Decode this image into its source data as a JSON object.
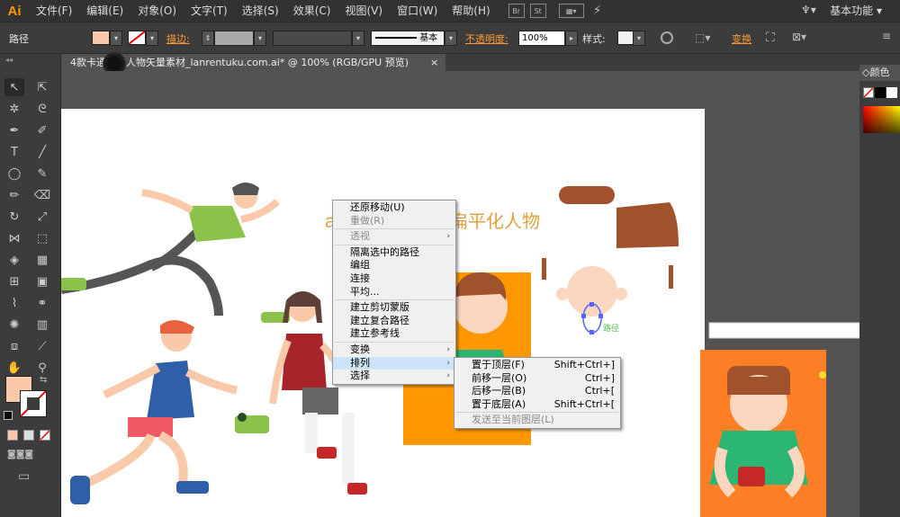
{
  "app": {
    "logo": "Ai",
    "workspace": "基本功能"
  },
  "menus": [
    "文件(F)",
    "编辑(E)",
    "对象(O)",
    "文字(T)",
    "选择(S)",
    "效果(C)",
    "视图(V)",
    "窗口(W)",
    "帮助(H)"
  ],
  "menubar_icons": [
    "Br",
    "St"
  ],
  "control": {
    "selection": "路径",
    "stroke_label": "描边:",
    "stroke_style": "基本",
    "opacity_label": "不透明度:",
    "opacity_value": "100%",
    "style_label": "样式:",
    "transform_label": "变换"
  },
  "document_tab": {
    "title": "4款卡通运动人物矢量素材_lanrentuku.com.ai* @ 100% (RGB/GPU 预览)",
    "close": "×"
  },
  "panel": {
    "color_title": "颜色"
  },
  "artwork": {
    "title_text": "扁平化人物",
    "small_label": "路径"
  },
  "context_menu": {
    "items": [
      {
        "label": "还原移动(U)",
        "disabled": false
      },
      {
        "label": "重做(R)",
        "disabled": true
      },
      {
        "sep": true
      },
      {
        "label": "透视",
        "disabled": true,
        "submenu": true
      },
      {
        "sep": true
      },
      {
        "label": "隔离选中的路径",
        "disabled": false
      },
      {
        "label": "编组",
        "disabled": false
      },
      {
        "label": "连接",
        "disabled": false
      },
      {
        "label": "平均...",
        "disabled": false
      },
      {
        "sep": true
      },
      {
        "label": "建立剪切蒙版",
        "disabled": false
      },
      {
        "label": "建立复合路径",
        "disabled": false
      },
      {
        "label": "建立参考线",
        "disabled": false
      },
      {
        "sep": true
      },
      {
        "label": "变换",
        "disabled": false,
        "submenu": true
      },
      {
        "label": "排列",
        "disabled": false,
        "submenu": true,
        "highlight": true
      },
      {
        "label": "选择",
        "disabled": false,
        "submenu": true
      }
    ]
  },
  "arrange_submenu": {
    "items": [
      {
        "label": "置于顶层(F)",
        "shortcut": "Shift+Ctrl+]"
      },
      {
        "label": "前移一层(O)",
        "shortcut": "Ctrl+]"
      },
      {
        "label": "后移一层(B)",
        "shortcut": "Ctrl+["
      },
      {
        "label": "置于底层(A)",
        "shortcut": "Shift+Ctrl+["
      },
      {
        "sep": true
      },
      {
        "label": "发送至当前图层(L)",
        "shortcut": "",
        "disabled": true
      }
    ]
  },
  "colors": {
    "accent": "#ff9a00",
    "fill_swatch": "#f9c9a9",
    "orange_card": "#ff9800",
    "brown": "#a0522d"
  }
}
